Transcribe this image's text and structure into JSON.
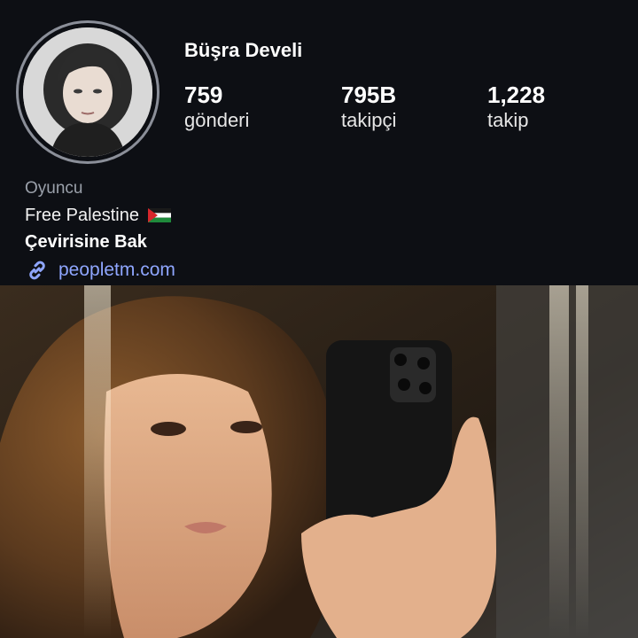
{
  "profile": {
    "username": "Büşra Develi",
    "stats": {
      "posts": {
        "value": "759",
        "label": "gönderi"
      },
      "followers": {
        "value": "795B",
        "label": "takipçi"
      },
      "following": {
        "value": "1,228",
        "label": "takip"
      }
    },
    "bio": {
      "category": "Oyuncu",
      "text": "Free Palestine",
      "flag_icon": "palestine-flag-icon",
      "translate_label": "Çevirisine Bak",
      "link_icon": "link-icon",
      "link_text": "peopletm.com"
    }
  },
  "colors": {
    "background": "#0d0f14",
    "link": "#8fa6ff",
    "muted_text": "#9aa0aa"
  }
}
